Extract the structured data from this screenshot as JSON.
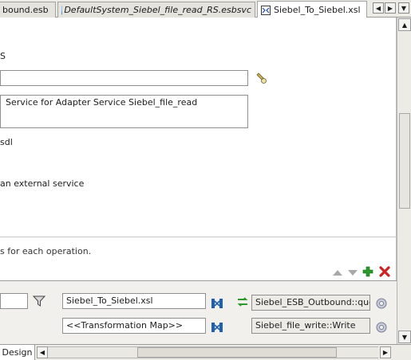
{
  "tabs": [
    {
      "label": "bound.esb",
      "active": false,
      "italic": false
    },
    {
      "label": "DefaultSystem_Siebel_file_read_RS.esbsvc",
      "active": false,
      "italic": true
    },
    {
      "label": "Siebel_To_Siebel.xsl",
      "active": true,
      "italic": false
    }
  ],
  "form": {
    "heading_fragment": "S",
    "name_value": "",
    "description_value": "Service for Adapter Service Siebel_file_read",
    "wsdl_fragment": "sdl",
    "external_service_fragment": "an external service",
    "operations_note": "s for each operation."
  },
  "routing_rows": [
    {
      "filter_value": "",
      "transformation": "Siebel_To_Siebel.xsl",
      "target": "Siebel_ESB_Outbound::query"
    },
    {
      "filter_value": "",
      "transformation": "<<Transformation Map>>",
      "target": "Siebel_file_write::Write"
    }
  ],
  "bottom": {
    "design_tab": "Design"
  },
  "colors": {
    "add": "#2a9a2a",
    "remove": "#cc2222",
    "map_icon": "#1f5fb0"
  }
}
